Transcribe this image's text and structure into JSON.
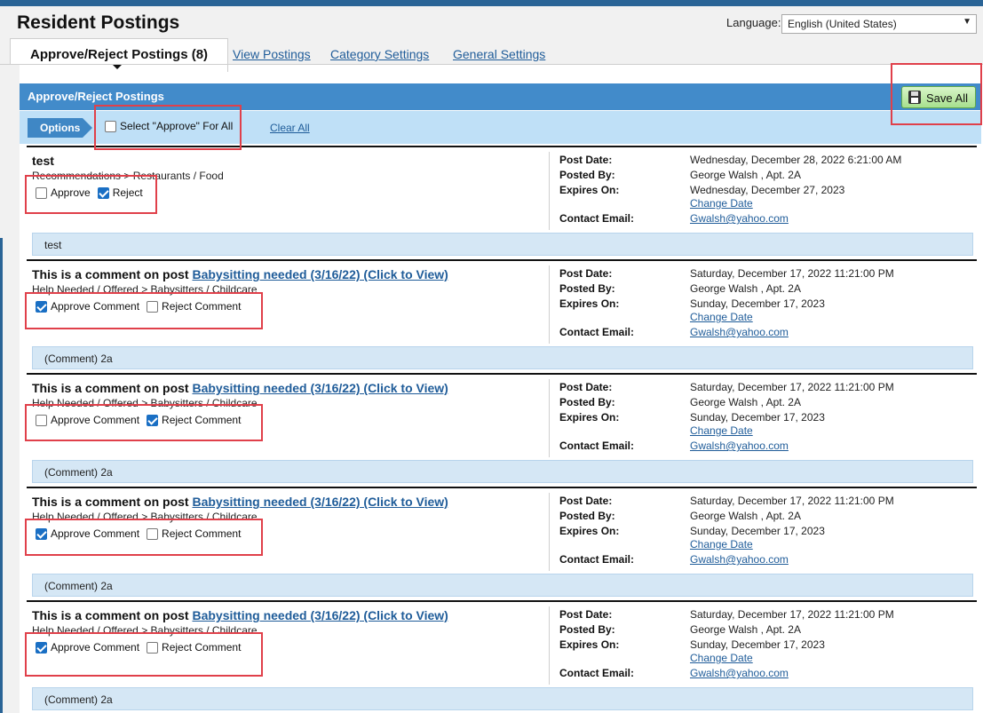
{
  "header": {
    "title": "Resident Postings",
    "language_label": "Language:",
    "language_value": "English (United States)",
    "tabs": [
      {
        "label": "Approve/Reject Postings (8)",
        "active": true
      },
      {
        "label": "View Postings",
        "active": false
      },
      {
        "label": "Category Settings",
        "active": false
      },
      {
        "label": "General Settings",
        "active": false
      }
    ]
  },
  "panel": {
    "title": "Approve/Reject Postings",
    "save_label": "Save All",
    "options_label": "Options",
    "select_all_label": "Select \"Approve\" For All",
    "clear_all_label": "Clear All"
  },
  "meta_labels": {
    "post_date": "Post Date:",
    "posted_by": "Posted By:",
    "expires_on": "Expires On:",
    "change_date": "Change Date",
    "contact_email": "Contact Email:"
  },
  "posts": [
    {
      "title_prefix": "test",
      "title_link": "",
      "category": "Recommendations > Restaurants / Food",
      "approve_label": "Approve",
      "reject_label": "Reject",
      "approve_checked": false,
      "reject_checked": true,
      "post_date": "Wednesday, December 28, 2022 6:21:00 AM",
      "posted_by": "George Walsh , Apt. 2A",
      "expires_on": "Wednesday, December 27, 2023",
      "email": "Gwalsh@yahoo.com",
      "body": "test"
    },
    {
      "title_prefix": "This is a comment on post ",
      "title_link": "Babysitting needed (3/16/22) (Click to View)",
      "category": "Help Needed / Offered > Babysitters / Childcare",
      "approve_label": "Approve Comment",
      "reject_label": "Reject Comment",
      "approve_checked": true,
      "reject_checked": false,
      "post_date": "Saturday, December 17, 2022 11:21:00 PM",
      "posted_by": "George Walsh , Apt. 2A",
      "expires_on": "Sunday, December 17, 2023",
      "email": "Gwalsh@yahoo.com",
      "body": "(Comment) 2a"
    },
    {
      "title_prefix": "This is a comment on post ",
      "title_link": "Babysitting needed (3/16/22) (Click to View)",
      "category": "Help Needed / Offered > Babysitters / Childcare",
      "approve_label": "Approve Comment",
      "reject_label": "Reject Comment",
      "approve_checked": false,
      "reject_checked": true,
      "post_date": "Saturday, December 17, 2022 11:21:00 PM",
      "posted_by": "George Walsh , Apt. 2A",
      "expires_on": "Sunday, December 17, 2023",
      "email": "Gwalsh@yahoo.com",
      "body": "(Comment) 2a"
    },
    {
      "title_prefix": "This is a comment on post ",
      "title_link": "Babysitting needed (3/16/22) (Click to View)",
      "category": "Help Needed / Offered > Babysitters / Childcare",
      "approve_label": "Approve Comment",
      "reject_label": "Reject Comment",
      "approve_checked": true,
      "reject_checked": false,
      "post_date": "Saturday, December 17, 2022 11:21:00 PM",
      "posted_by": "George Walsh , Apt. 2A",
      "expires_on": "Sunday, December 17, 2023",
      "email": "Gwalsh@yahoo.com",
      "body": "(Comment) 2a"
    },
    {
      "title_prefix": "This is a comment on post ",
      "title_link": "Babysitting needed (3/16/22) (Click to View)",
      "category": "Help Needed / Offered > Babysitters / Childcare",
      "approve_label": "Approve Comment",
      "reject_label": "Reject Comment",
      "approve_checked": true,
      "reject_checked": false,
      "post_date": "Saturday, December 17, 2022 11:21:00 PM",
      "posted_by": "George Walsh , Apt. 2A",
      "expires_on": "Sunday, December 17, 2023",
      "email": "Gwalsh@yahoo.com",
      "body": "(Comment) 2a"
    }
  ]
}
